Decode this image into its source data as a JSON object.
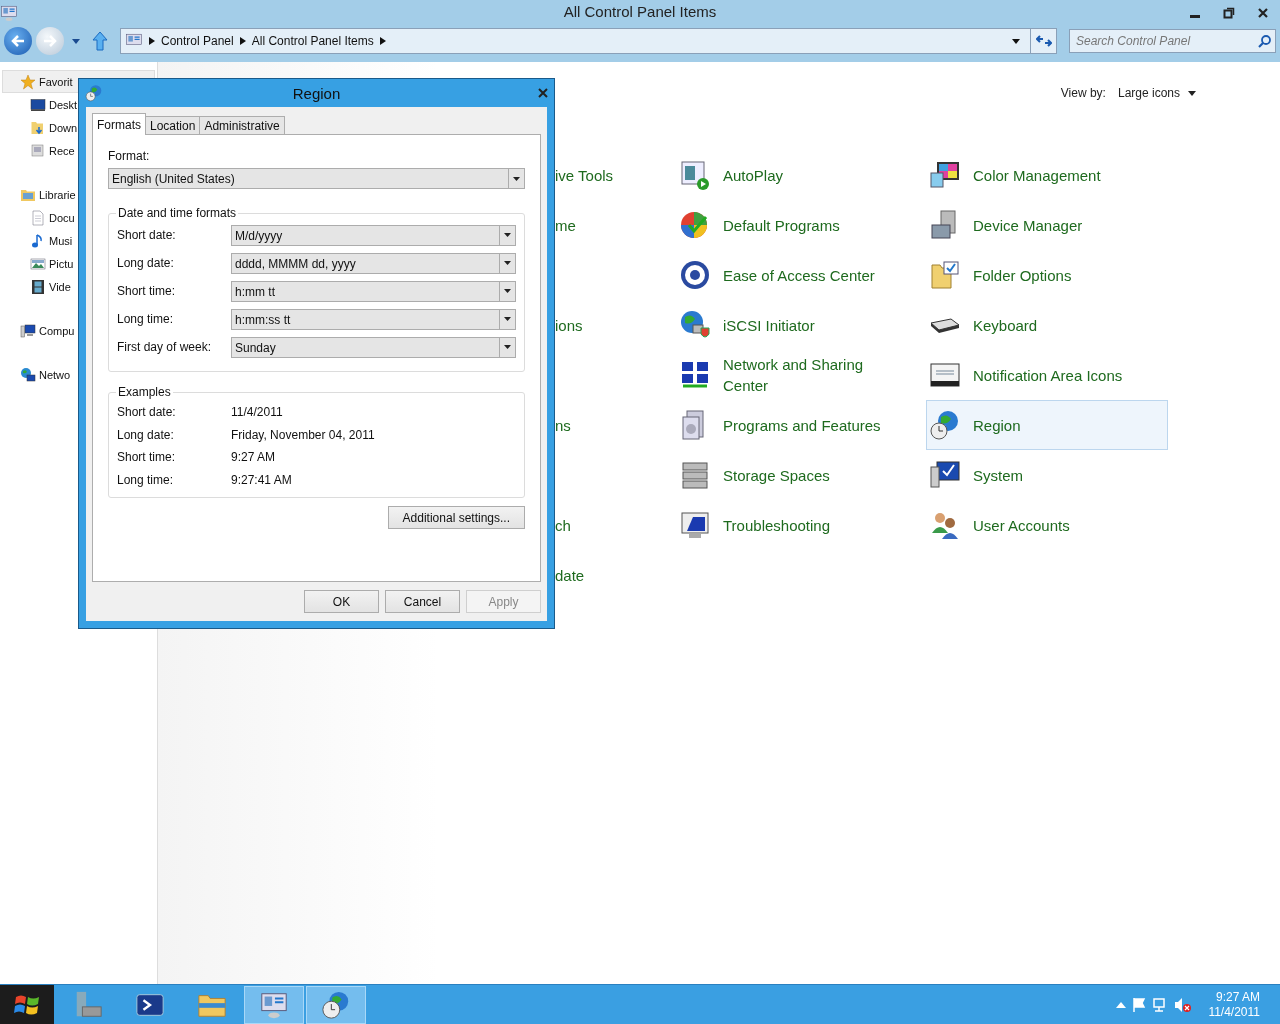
{
  "window": {
    "title": "All Control Panel Items"
  },
  "address_bar": {
    "crumbs": [
      "Control Panel",
      "All Control Panel Items"
    ]
  },
  "search": {
    "placeholder": "Search Control Panel"
  },
  "view_by": {
    "label": "View by:",
    "value": "Large icons"
  },
  "sidebar": {
    "items": [
      {
        "label": "Favorit",
        "selected": true,
        "children": [
          {
            "label": "Deskt",
            "selected": false
          },
          {
            "label": "Down",
            "selected": false
          },
          {
            "label": "Rece",
            "selected": false
          }
        ]
      },
      {
        "label": "Librarie",
        "selected": false,
        "children": [
          {
            "label": "Docu",
            "selected": false
          },
          {
            "label": "Musi",
            "selected": false
          },
          {
            "label": "Pictu",
            "selected": false
          },
          {
            "label": "Vide",
            "selected": false
          }
        ]
      },
      {
        "label": "Compu",
        "selected": false
      },
      {
        "label": "Netwo",
        "selected": false
      }
    ]
  },
  "items": {
    "rows": [
      {
        "left_fragment": "ive Tools",
        "items": [
          {
            "label": "AutoPlay",
            "selected": false
          },
          {
            "label": "Color Management",
            "selected": false
          }
        ]
      },
      {
        "left_fragment": "me",
        "items": [
          {
            "label": "Default Programs",
            "selected": false
          },
          {
            "label": "Device Manager",
            "selected": false
          }
        ]
      },
      {
        "items": [
          {
            "label": "Ease of Access Center",
            "selected": false
          },
          {
            "label": "Folder Options",
            "selected": false
          }
        ]
      },
      {
        "left_fragment": "ions",
        "items": [
          {
            "label": "iSCSI Initiator",
            "selected": false
          },
          {
            "label": "Keyboard",
            "selected": false
          }
        ]
      },
      {
        "items": [
          {
            "label": "Network and Sharing Center",
            "selected": false
          },
          {
            "label": "Notification Area Icons",
            "selected": false
          }
        ]
      },
      {
        "left_fragment": "ns",
        "items": [
          {
            "label": "Programs and Features",
            "selected": false
          },
          {
            "label": "Region",
            "selected": true
          }
        ]
      },
      {
        "items": [
          {
            "label": "Storage Spaces",
            "selected": false
          },
          {
            "label": "System",
            "selected": false
          }
        ]
      },
      {
        "left_fragment": "ch",
        "items": [
          {
            "label": "Troubleshooting",
            "selected": false
          },
          {
            "label": "User Accounts",
            "selected": false
          }
        ]
      },
      {
        "left_fragment": "date"
      }
    ]
  },
  "dialog": {
    "title": "Region",
    "tabs": [
      {
        "label": "Formats",
        "selected": true
      },
      {
        "label": "Location",
        "selected": false
      },
      {
        "label": "Administrative",
        "selected": false
      }
    ],
    "format": {
      "label": "Format:",
      "value": "English (United States)"
    },
    "formats_group": {
      "title": "Date and time formats",
      "rows": [
        {
          "label": "Short date:",
          "value": "M/d/yyyy"
        },
        {
          "label": "Long date:",
          "value": "dddd, MMMM dd, yyyy"
        },
        {
          "label": "Short time:",
          "value": "h:mm tt"
        },
        {
          "label": "Long time:",
          "value": "h:mm:ss tt"
        },
        {
          "label": "First day of week:",
          "value": "Sunday"
        }
      ]
    },
    "examples_group": {
      "title": "Examples",
      "rows": [
        {
          "label": "Short date:",
          "value": "11/4/2011"
        },
        {
          "label": "Long date:",
          "value": "Friday, November 04, 2011"
        },
        {
          "label": "Short time:",
          "value": "9:27 AM"
        },
        {
          "label": "Long time:",
          "value": "9:27:41 AM"
        }
      ]
    },
    "additional_button": "Additional settings...",
    "buttons": [
      {
        "label": "OK",
        "disabled": false
      },
      {
        "label": "Cancel",
        "disabled": false
      },
      {
        "label": "Apply",
        "disabled": true
      }
    ]
  },
  "taskbar": {
    "apps": [
      {
        "active": false
      },
      {
        "active": false
      },
      {
        "active": false
      },
      {
        "active": true
      },
      {
        "active": true
      }
    ],
    "clock": {
      "time": "9:27 AM",
      "date": "11/4/2011"
    }
  }
}
